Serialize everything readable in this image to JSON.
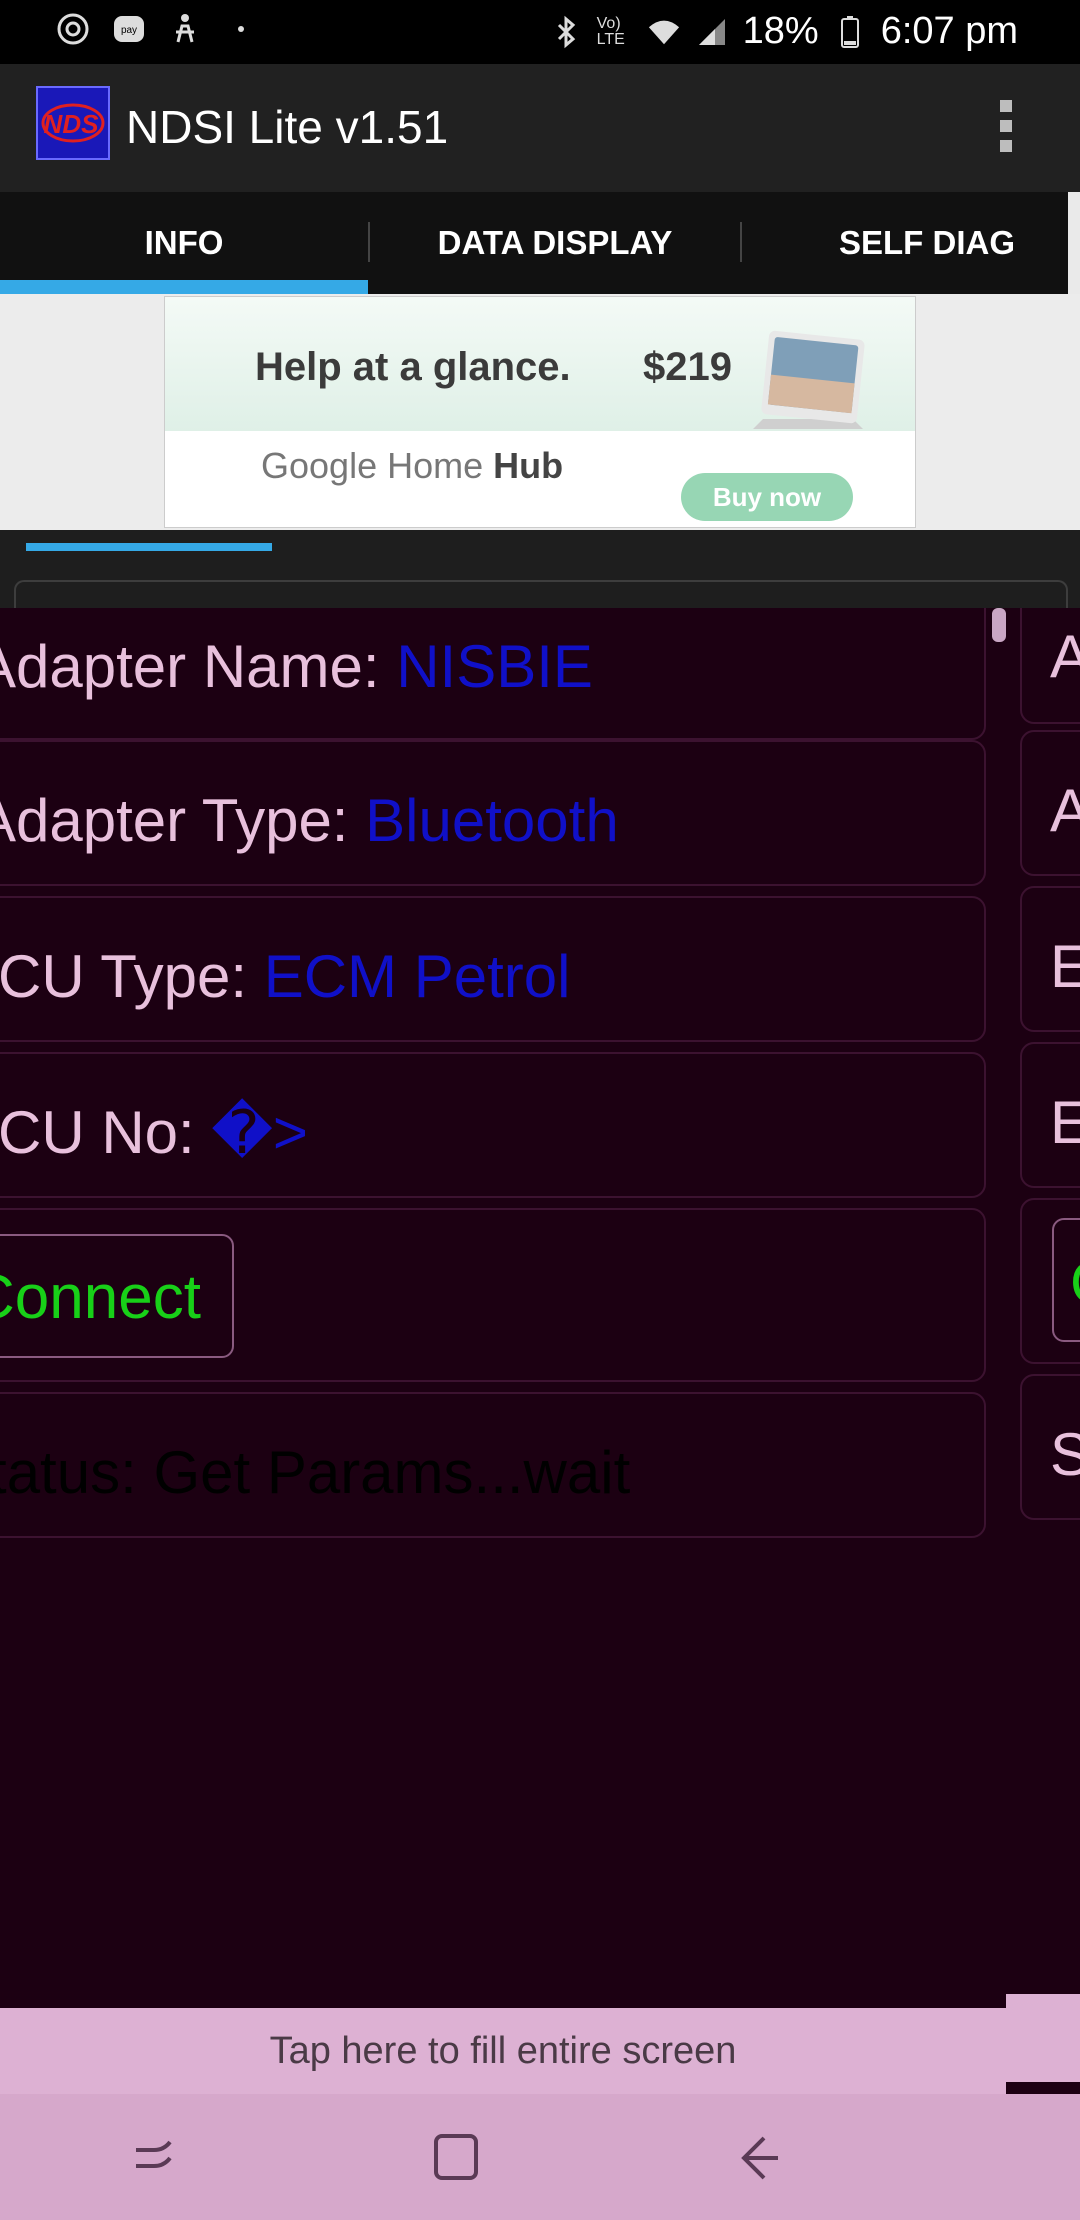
{
  "status_bar": {
    "left_icons": [
      "sync-icon",
      "pay-icon",
      "accessibility-icon",
      "dot-icon"
    ],
    "right_icons": [
      "bluetooth-icon",
      "volte-icon",
      "wifi-icon",
      "signal-icon",
      "battery-icon"
    ],
    "volte": "Vo) LTE",
    "battery_percent": "18%",
    "time": "6:07 pm"
  },
  "app_bar": {
    "logo_text": "NDS",
    "title": "NDSI Lite v1.51",
    "menu_icon": "more-vert-icon"
  },
  "tabs": [
    {
      "label": "INFO",
      "selected": true
    },
    {
      "label": "DATA DISPLAY",
      "selected": false
    },
    {
      "label": "SELF DIAG",
      "selected": false
    }
  ],
  "ad": {
    "headline": "Help at a glance.",
    "price": "$219",
    "brand_google": "Google Home",
    "brand_product": "Hub",
    "cta": "Buy now"
  },
  "info": {
    "adapter_name_label": "Adapter Name:",
    "adapter_name_value": "NISBIE",
    "adapter_type_label": "Adapter Type:",
    "adapter_type_value": "Bluetooth",
    "ecu_type_label": "ECU Type:",
    "ecu_type_value": "ECM Petrol",
    "ecu_no_label": "ECU No:",
    "ecu_no_value": "�>",
    "connect_label": "Connect",
    "status_text": "Status: Get Params...wait"
  },
  "right_panel_letters": [
    "A",
    "A",
    "E",
    "E",
    "C",
    "S"
  ],
  "fill_screen_text": "Tap here to fill entire screen",
  "nav_bar": {
    "buttons": [
      "recent-apps-icon",
      "home-icon",
      "back-icon"
    ]
  },
  "colors": {
    "background": "#1c0012",
    "label": "#e8c0dc",
    "value": "#1010c8",
    "connect": "#18d018",
    "tab_indicator": "#35a9e6"
  }
}
